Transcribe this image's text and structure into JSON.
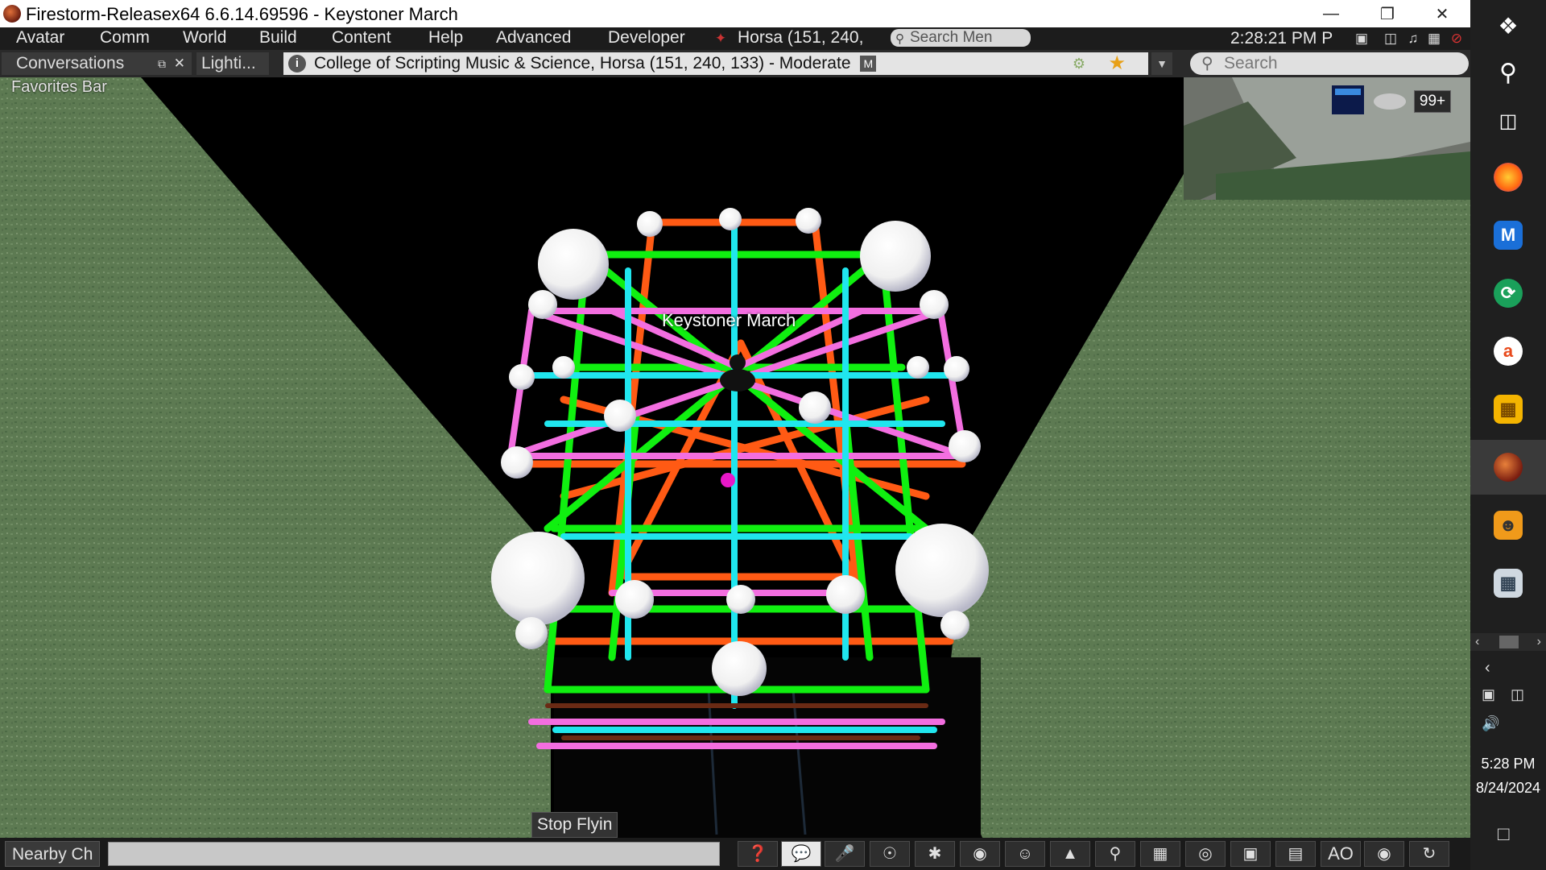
{
  "window": {
    "title": "Firestorm-Releasex64 6.6.14.69596 - Keystoner March",
    "controls": [
      "minimize",
      "restore",
      "close"
    ]
  },
  "menubar": {
    "items": [
      "Avatar",
      "Comm",
      "World",
      "Build",
      "Content",
      "Help",
      "Advanced",
      "Developer"
    ],
    "region_label": "Horsa (151, 240,",
    "search_placeholder": "Search Men",
    "clock": "2:28:21 PM P"
  },
  "navbar": {
    "conversations_label": "Conversations",
    "lighting_label": "Lighti...",
    "location": "College of Scripting Music & Science, Horsa (151, 240, 133) - Moderate",
    "rating_badge": "M",
    "search_placeholder": "Search"
  },
  "favorites_bar": "Favorites Bar",
  "minimap": {
    "badge": "99+"
  },
  "scene": {
    "avatar_name": "Keystoner March",
    "stop_flying": "Stop Flyin"
  },
  "bottombar": {
    "nearby_chat": "Nearby Ch",
    "ao_label": "AO",
    "toolbar_icons": [
      "help-icon",
      "chat-icon",
      "mic-icon",
      "headphones-icon",
      "walk-icon",
      "eye-icon",
      "people-icon",
      "outfit-icon",
      "search-icon",
      "map-icon",
      "radar-icon",
      "snapshot-icon",
      "inventory-icon",
      "ao-icon",
      "places-icon",
      "hover-icon"
    ]
  },
  "taskbar": {
    "apps": [
      "windows-start-icon",
      "search-icon",
      "task-view-icon",
      "firefox-icon",
      "m-app-icon",
      "green-app-icon",
      "orange-app-icon",
      "folder-app-icon",
      "firestorm-icon",
      "cat-app-icon",
      "printer-app-icon"
    ],
    "time": "5:28 PM",
    "date": "8/24/2024"
  }
}
